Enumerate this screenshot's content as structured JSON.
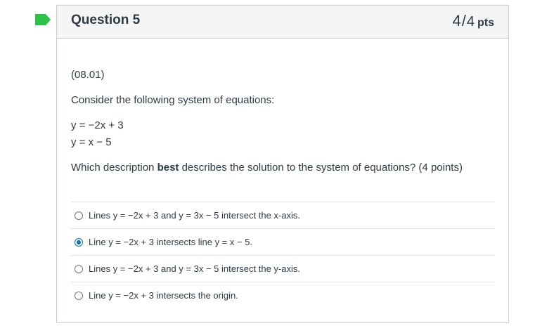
{
  "question": {
    "title": "Question 5",
    "score": "4",
    "separator": "/",
    "total": "4",
    "unit": "pts",
    "code": "(08.01)",
    "prompt": "Consider the following system of equations:",
    "equation_1": "y = −2x + 3",
    "equation_2": "y = x − 5",
    "ask_before": "Which description ",
    "ask_bold": "best",
    "ask_after": " describes the solution to the system of equations? (4 points)"
  },
  "answers": [
    {
      "label": "Lines y = −2x + 3 and y = 3x − 5 intersect the x-axis.",
      "selected": false
    },
    {
      "label": "Line y = −2x + 3 intersects line y = x − 5.",
      "selected": true
    },
    {
      "label": "Lines y = −2x + 3 and y = 3x − 5 intersect the y-axis.",
      "selected": false
    },
    {
      "label": "Line y = −2x + 3 intersects the origin.",
      "selected": false
    }
  ],
  "colors": {
    "flag": "#2ec24a",
    "accent": "#0374b5",
    "header_bg": "#f5f5f5",
    "border": "#c7cdd1"
  },
  "icons": {
    "flag": "correct-flag-icon",
    "radio": "radio-button-icon"
  }
}
